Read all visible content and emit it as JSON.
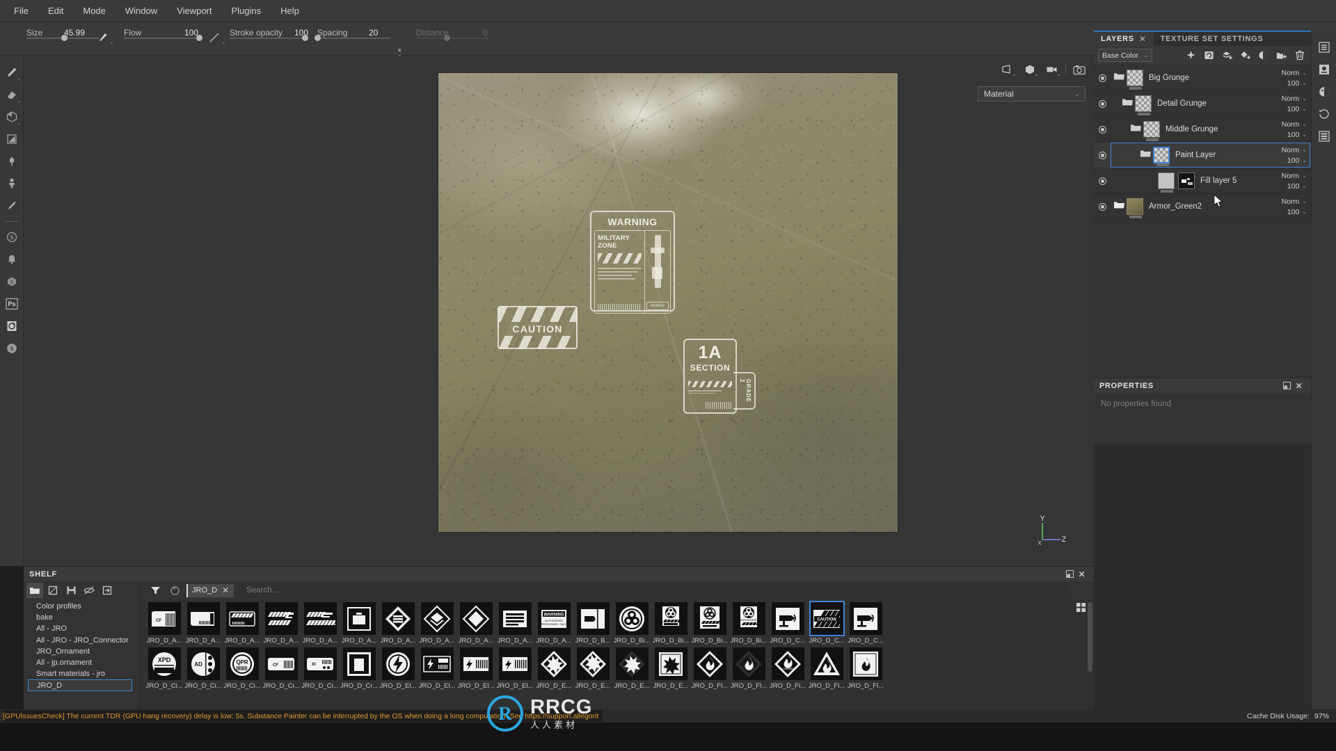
{
  "app": {
    "menu": [
      "File",
      "Edit",
      "Mode",
      "Window",
      "Viewport",
      "Plugins",
      "Help"
    ]
  },
  "toolbar": {
    "size_label": "Size",
    "size_value": "45.99",
    "flow_label": "Flow",
    "flow_value": "100",
    "stroke_opacity_label": "Stroke opacity",
    "stroke_opacity_value": "100",
    "spacing_label": "Spacing",
    "spacing_value": "20",
    "distance_label": "Distance",
    "distance_value": "0"
  },
  "viewport": {
    "material_dropdown": "Material",
    "axis_x": "X",
    "axis_y": "Y",
    "axis_z": "Z",
    "decals": {
      "caution": "CAUTION",
      "warning_title": "WARNING",
      "warning_zone": "MILITARY ZONE",
      "warning_armed": "ARMED",
      "section_number": "1A",
      "section_label": "SECTION",
      "section_grade": "GRADE 2"
    }
  },
  "layers_panel": {
    "tab_layers": "LAYERS",
    "tab_texture_set": "TEXTURE SET SETTINGS",
    "channel": "Base Color",
    "tools": [
      "anchor-point-icon",
      "refresh-icon",
      "add-layer-icon",
      "add-fill-layer-icon",
      "add-mask-icon",
      "add-folder-icon",
      "delete-layer-icon"
    ],
    "layers": [
      {
        "name": "Big Grunge",
        "blend": "Norm",
        "opacity": "100",
        "type": "folder",
        "indent": 0,
        "selected": false,
        "thumb": "checker"
      },
      {
        "name": "Detail Grunge",
        "blend": "Norm",
        "opacity": "100",
        "type": "folder",
        "indent": 1,
        "selected": false,
        "thumb": "checker"
      },
      {
        "name": "Middle Grunge",
        "blend": "Norm",
        "opacity": "100",
        "type": "folder",
        "indent": 2,
        "selected": false,
        "thumb": "checker"
      },
      {
        "name": "Paint Layer",
        "blend": "Norm",
        "opacity": "100",
        "type": "folder",
        "indent": 3,
        "selected": true,
        "thumb": "checker"
      },
      {
        "name": "Fill layer 5",
        "blend": "Norm",
        "opacity": "100",
        "type": "fill",
        "indent": 4,
        "selected": false,
        "thumb": "fill-mask"
      },
      {
        "name": "Armor_Green2",
        "blend": "Norm",
        "opacity": "100",
        "type": "folder",
        "indent": 0,
        "selected": false,
        "thumb": "armor"
      }
    ]
  },
  "properties_panel": {
    "title": "PROPERTIES",
    "empty_message": "No properties found"
  },
  "shelf": {
    "title": "SHELF",
    "categories": [
      "Color profiles",
      "bake",
      "All - JRO",
      "All - JRO - JRO_Connector",
      "JRO_Ornament",
      "All - jp.ornament",
      "Smart materials - jro",
      "JRO_D"
    ],
    "selected_category": "JRO_D",
    "filter_chip": "JRO_D",
    "search_placeholder": "Search...",
    "assets_row1": [
      {
        "label": "JRO_D_A...",
        "icon": "label-cf-barcode",
        "selected": false
      },
      {
        "label": "JRO_D_A...",
        "icon": "label-tag-barcode",
        "selected": false
      },
      {
        "label": "JRO_D_A...",
        "icon": "label-hazard-card",
        "selected": false
      },
      {
        "label": "JRO_D_A...",
        "icon": "label-hazard-strip",
        "selected": false
      },
      {
        "label": "JRO_D_A...",
        "icon": "label-hazard-wide",
        "selected": false
      },
      {
        "label": "JRO_D_A...",
        "icon": "container-box",
        "selected": false
      },
      {
        "label": "JRO_D_A...",
        "icon": "diamond-stack",
        "selected": false
      },
      {
        "label": "JRO_D_A...",
        "icon": "diamond-layers",
        "selected": false
      },
      {
        "label": "JRO_D_A...",
        "icon": "diamond-plain",
        "selected": false
      },
      {
        "label": "JRO_D_A...",
        "icon": "list-lines",
        "selected": false
      },
      {
        "label": "JRO_D_A...",
        "icon": "warning-authorized",
        "selected": false
      },
      {
        "label": "JRO_D_B...",
        "icon": "bullet-box",
        "selected": false
      },
      {
        "label": "JRO_D_Bi...",
        "icon": "biohazard-circle",
        "selected": false
      },
      {
        "label": "JRO_D_Bi...",
        "icon": "biohazard-tag",
        "selected": false
      },
      {
        "label": "JRO_D_Bi...",
        "icon": "biohazard-plate",
        "selected": false
      },
      {
        "label": "JRO_D_Bi...",
        "icon": "biohazard-label",
        "selected": false
      },
      {
        "label": "JRO_D_C...",
        "icon": "cctv-camera",
        "selected": false
      },
      {
        "label": "JRO_D_C...",
        "icon": "caution-stripes",
        "selected": true
      },
      {
        "label": "JRO_D_C...",
        "icon": "cctv-camera-2",
        "selected": false
      }
    ],
    "assets_row2": [
      {
        "label": "JRO_D_Ci...",
        "icon": "circle-xpd",
        "selected": false
      },
      {
        "label": "JRO_D_Ci...",
        "icon": "circle-ad",
        "selected": false
      },
      {
        "label": "JRO_D_Ci...",
        "icon": "circle-qpr",
        "selected": false
      },
      {
        "label": "JRO_D_Ci...",
        "icon": "card-cf",
        "selected": false
      },
      {
        "label": "JRO_D_Ci...",
        "icon": "card-xi",
        "selected": false
      },
      {
        "label": "JRO_D_Cr...",
        "icon": "crate-square",
        "selected": false
      },
      {
        "label": "JRO_D_El...",
        "icon": "circle-bolt",
        "selected": false
      },
      {
        "label": "JRO_D_El...",
        "icon": "panel-bolt",
        "selected": false
      },
      {
        "label": "JRO_D_El...",
        "icon": "box-bolt",
        "selected": false
      },
      {
        "label": "JRO_D_El...",
        "icon": "box-bolt-2",
        "selected": false
      },
      {
        "label": "JRO_D_E...",
        "icon": "diamond-explosive",
        "selected": false
      },
      {
        "label": "JRO_D_E...",
        "icon": "diamond-explosive-label",
        "selected": false
      },
      {
        "label": "JRO_D_E...",
        "icon": "diamond-explosive-dark",
        "selected": false
      },
      {
        "label": "JRO_D_E...",
        "icon": "square-explosive",
        "selected": false
      },
      {
        "label": "JRO_D_Fl...",
        "icon": "diamond-flame",
        "selected": false
      },
      {
        "label": "JRO_D_Fl...",
        "icon": "diamond-flame-dark",
        "selected": false
      },
      {
        "label": "JRO_D_Fl...",
        "icon": "diamond-flammable",
        "selected": false
      },
      {
        "label": "JRO_D_Fl...",
        "icon": "triangle-flame",
        "selected": false
      },
      {
        "label": "JRO_D_Fl...",
        "icon": "square-flame",
        "selected": false
      }
    ]
  },
  "status": {
    "message": "[GPUIssuesCheck] The current TDR (GPU hang recovery) delay is low: 5s. Substance Painter can be interrupted by the OS when doing a long computation. See https://support.allegorit",
    "cache_label": "Cache Disk Usage:",
    "cache_value": "97%"
  },
  "watermark": {
    "badge": "R",
    "name": "RRCG",
    "subtitle": "人人素材"
  },
  "colors": {
    "accent_blue": "#3f86d8",
    "panel_bg": "#333333",
    "toolbar_bg": "#3a3a3a",
    "warning_orange": "#e09a2c"
  }
}
